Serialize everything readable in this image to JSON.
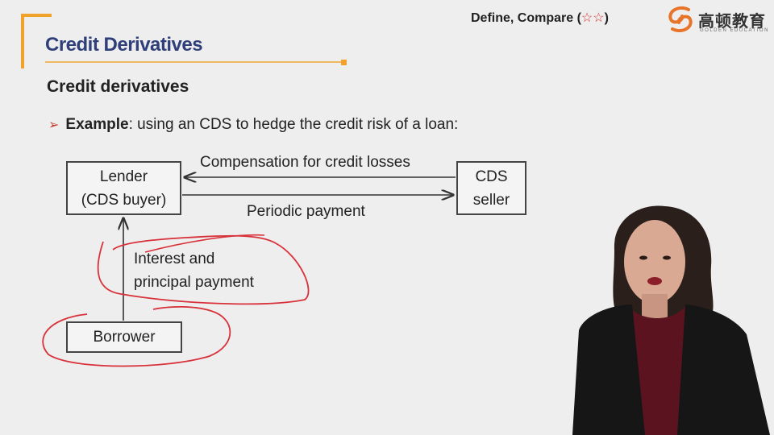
{
  "header": {
    "title": "Credit Derivatives",
    "level_prefix": "Define, Compare (",
    "level_stars": "☆☆",
    "level_suffix": ")",
    "logo_cn": "高顿教育",
    "logo_en": "GOLDEN EDUCATION"
  },
  "content": {
    "subtitle": "Credit derivatives",
    "bullet_bold": "Example",
    "bullet_text": ": using an CDS to hedge the credit risk of a loan:"
  },
  "diagram": {
    "lender_line1": "Lender",
    "lender_line2": "(CDS buyer)",
    "seller_line1": "CDS",
    "seller_line2": "seller",
    "borrower": "Borrower",
    "arrow_top_label": "Compensation for credit losses",
    "arrow_bottom_label": "Periodic payment",
    "vertical_label_line1": "Interest and",
    "vertical_label_line2": "principal payment"
  },
  "colors": {
    "title": "#2f3f7a",
    "accent_orange": "#f0a22a",
    "annotation_red": "#d8313a"
  }
}
